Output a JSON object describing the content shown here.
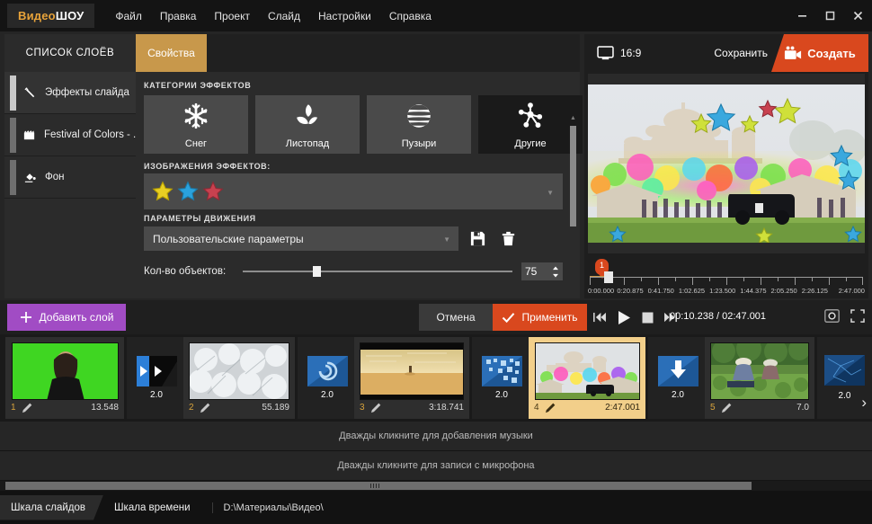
{
  "titlebar": {
    "brand_part1": "Видео",
    "brand_part2": "ШОУ",
    "menu": [
      "Файл",
      "Правка",
      "Проект",
      "Слайд",
      "Настройки",
      "Справка"
    ],
    "minimize": "—",
    "maximize": "□",
    "close": "✕"
  },
  "tabs": {
    "layers_tab": "СПИСОК СЛОЁВ",
    "properties_tab": "Свойства"
  },
  "layers": [
    {
      "label": "Эффекты слайда",
      "icon": "magic-wand-icon",
      "selected": true
    },
    {
      "label": "Festival of Colors - ...",
      "icon": "film-clip-icon",
      "selected": false
    },
    {
      "label": "Фон",
      "icon": "paint-bucket-icon",
      "selected": false
    }
  ],
  "properties": {
    "categories_label": "КАТЕГОРИИ ЭФФЕКТОВ",
    "categories": [
      {
        "label": "Снег",
        "icon": "snowflake-icon",
        "active": false
      },
      {
        "label": "Листопад",
        "icon": "leaves-icon",
        "active": false
      },
      {
        "label": "Пузыри",
        "icon": "bubble-sphere-icon",
        "active": false
      },
      {
        "label": "Другие",
        "icon": "molecule-icon",
        "active": true
      }
    ],
    "images_label": "ИЗОБРАЖЕНИЯ ЭФФЕКТОВ:",
    "images_selected": [
      "yellow-star",
      "blue-star",
      "red-star"
    ],
    "motion_label": "ПАРАМЕТРЫ ДВИЖЕНИЯ",
    "preset_value": "Пользовательские параметры",
    "save_preset_icon": "floppy-disk-icon",
    "delete_preset_icon": "trash-icon",
    "count_label": "Кол-во объектов:",
    "count_value": "75",
    "count_percent": 26
  },
  "preview": {
    "ratio_label": "16:9",
    "ratio_icon": "monitor-icon",
    "save_label": "Сохранить",
    "create_label": "Создать",
    "create_icon": "video-camera-icon",
    "marker_number": "1",
    "ruler_labels": [
      "0:00.000",
      "0:20.875",
      "0:41.750",
      "1:02.625",
      "1:23.500",
      "1:44.375",
      "2:05.250",
      "2:26.125",
      "2:47.000"
    ]
  },
  "actionbar": {
    "add_layer_label": "Добавить слой",
    "add_layer_icon": "plus-icon",
    "cancel_label": "Отмена",
    "apply_label": "Применить",
    "apply_icon": "check-icon",
    "prev_icon": "skip-previous-icon",
    "play_icon": "play-icon",
    "stop_icon": "stop-icon",
    "next_icon": "skip-next-icon",
    "timecode": "00:10.238 / 02:47.001",
    "snapshot_icon": "camera-icon",
    "fullscreen_icon": "fullscreen-icon"
  },
  "timeline": {
    "slides": [
      {
        "number": "1",
        "duration": "13.548",
        "selected": false,
        "image": "woman-green-screen"
      },
      {
        "number": "2",
        "duration": "55.189",
        "selected": false,
        "image": "snowy-bush"
      },
      {
        "number": "3",
        "duration": "3:18.741",
        "selected": false,
        "image": "desert-person-sunset"
      },
      {
        "number": "4",
        "duration": "2:47.001",
        "selected": true,
        "image": "holi-festival-temple"
      },
      {
        "number": "5",
        "duration": "7.0",
        "selected": false,
        "image": "farmers-in-field"
      }
    ],
    "transitions": [
      {
        "duration": "2.0",
        "icon": "slide-left-icon"
      },
      {
        "duration": "2.0",
        "icon": "spiral-icon"
      },
      {
        "duration": "2.0",
        "icon": "mosaic-icon"
      },
      {
        "duration": "2.0",
        "icon": "arrow-down-icon"
      },
      {
        "duration": "2.0",
        "icon": "shatter-icon"
      }
    ],
    "edit_icon": "pencil-icon",
    "next_arrow": "›"
  },
  "audio": {
    "music_hint": "Дважды кликните для добавления музыки",
    "mic_hint": "Дважды кликните для записи с микрофона"
  },
  "statusbar": {
    "slides_scale_tab": "Шкала слайдов",
    "time_scale_tab": "Шкала времени",
    "path": "D:\\Материалы\\Видео\\"
  },
  "colors": {
    "accent_orange": "#d9481e",
    "accent_gold": "#c8984b",
    "accent_purple": "#a14cc4",
    "selection_yellow": "#f2cf8a",
    "panel_bg": "#2b2b2b",
    "window_bg": "#1b1b1b"
  }
}
